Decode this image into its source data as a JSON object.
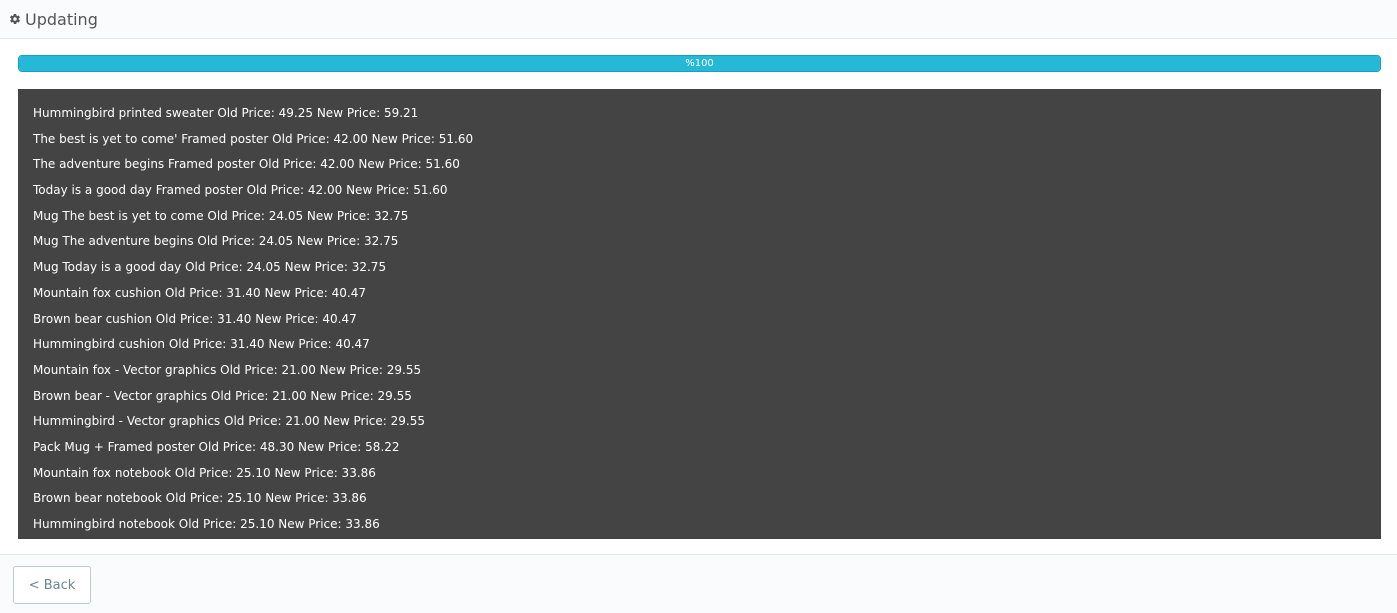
{
  "header": {
    "icon": "gear-icon",
    "title": "Updating"
  },
  "progress": {
    "percent": 100,
    "label": "%100",
    "color": "#25b9d7"
  },
  "log": {
    "background": "#444444",
    "lines": [
      "Hummingbird printed sweater Old Price: 49.25 New Price: 59.21",
      "The best is yet to come' Framed poster Old Price: 42.00 New Price: 51.60",
      "The adventure begins Framed poster Old Price: 42.00 New Price: 51.60",
      "Today is a good day Framed poster Old Price: 42.00 New Price: 51.60",
      "Mug The best is yet to come Old Price: 24.05 New Price: 32.75",
      "Mug The adventure begins Old Price: 24.05 New Price: 32.75",
      "Mug Today is a good day Old Price: 24.05 New Price: 32.75",
      "Mountain fox cushion Old Price: 31.40 New Price: 40.47",
      "Brown bear cushion Old Price: 31.40 New Price: 40.47",
      "Hummingbird cushion Old Price: 31.40 New Price: 40.47",
      "Mountain fox - Vector graphics Old Price: 21.00 New Price: 29.55",
      "Brown bear - Vector graphics Old Price: 21.00 New Price: 29.55",
      "Hummingbird - Vector graphics Old Price: 21.00 New Price: 29.55",
      "Pack Mug + Framed poster Old Price: 48.30 New Price: 58.22",
      "Mountain fox notebook Old Price: 25.10 New Price: 33.86",
      "Brown bear notebook Old Price: 25.10 New Price: 33.86",
      "Hummingbird notebook Old Price: 25.10 New Price: 33.86"
    ]
  },
  "footer": {
    "back_label": "< Back"
  }
}
